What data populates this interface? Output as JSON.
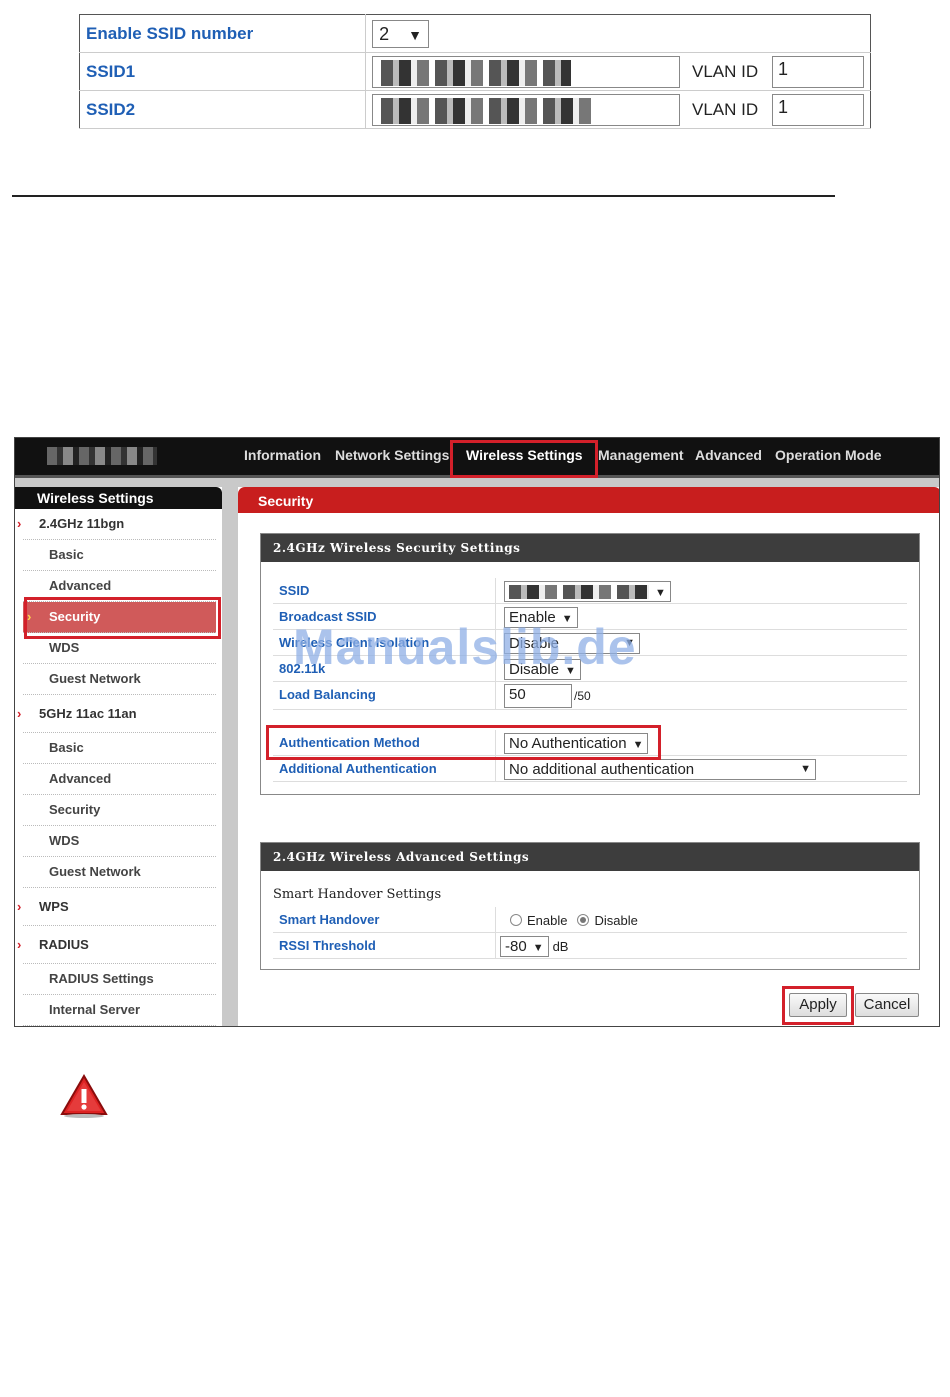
{
  "ssid_table": {
    "enable_label": "Enable SSID number",
    "enable_value": "2",
    "rows": [
      {
        "label": "SSID1",
        "vlan_label": "VLAN ID",
        "vlan_value": "1"
      },
      {
        "label": "SSID2",
        "vlan_label": "VLAN ID",
        "vlan_value": "1"
      }
    ]
  },
  "router": {
    "nav": [
      "Information",
      "Network Settings",
      "Wireless Settings",
      "Management",
      "Advanced",
      "Operation Mode"
    ],
    "active_nav": "Wireless Settings",
    "sidebar": {
      "title": "Wireless Settings",
      "items": [
        {
          "label": "2.4GHz 11bgn"
        },
        {
          "label": "Basic"
        },
        {
          "label": "Advanced"
        },
        {
          "label": "Security"
        },
        {
          "label": "WDS"
        },
        {
          "label": "Guest Network"
        },
        {
          "label": "5GHz 11ac 11an"
        },
        {
          "label": "Basic"
        },
        {
          "label": "Advanced"
        },
        {
          "label": "Security"
        },
        {
          "label": "WDS"
        },
        {
          "label": "Guest Network"
        },
        {
          "label": "WPS"
        },
        {
          "label": "RADIUS"
        },
        {
          "label": "RADIUS Settings"
        },
        {
          "label": "Internal Server"
        }
      ]
    },
    "section_title": "Security",
    "security_panel": {
      "title": "2.4GHz Wireless Security Settings",
      "ssid_label": "SSID",
      "broadcast_label": "Broadcast SSID",
      "broadcast_value": "Enable",
      "isolation_label": "Wireless Client Isolation",
      "isolation_value": "Disable",
      "k_label": "802.11k",
      "k_value": "Disable",
      "lb_label": "Load Balancing",
      "lb_value": "50",
      "lb_suffix": "/50",
      "auth_label": "Authentication Method",
      "auth_value": "No Authentication",
      "addauth_label": "Additional Authentication",
      "addauth_value": "No additional authentication"
    },
    "advanced_panel": {
      "title": "2.4GHz Wireless Advanced Settings",
      "subtitle": "Smart Handover Settings",
      "handover_label": "Smart Handover",
      "enable_label": "Enable",
      "disable_label": "Disable",
      "handover_selected": "Disable",
      "rssi_label": "RSSI Threshold",
      "rssi_value": "-80",
      "rssi_unit": "dB"
    },
    "apply_label": "Apply",
    "cancel_label": "Cancel"
  },
  "watermark": "Manualslib.de",
  "colors": {
    "accent": "#c81e1e",
    "link": "#1f5fb5",
    "highlight": "#d3202a"
  }
}
